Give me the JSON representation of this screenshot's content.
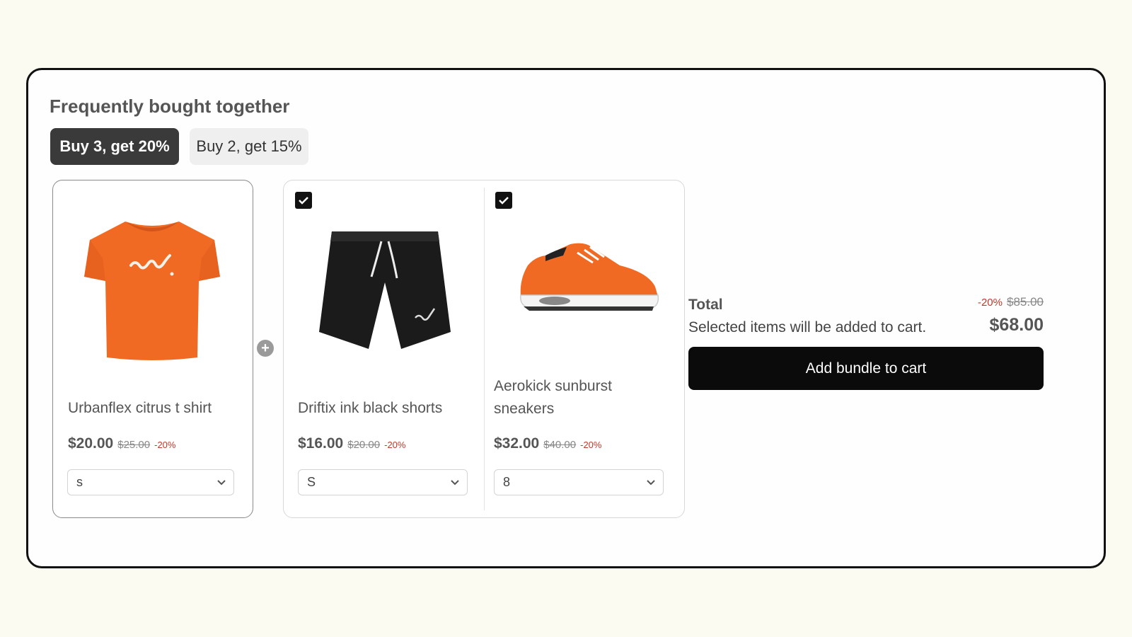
{
  "section": {
    "title": "Frequently bought together"
  },
  "tabs": [
    {
      "label": "Buy 3, get 20%",
      "active": true
    },
    {
      "label": "Buy 2, get 15%",
      "active": false
    }
  ],
  "products": [
    {
      "name": "Urbanflex citrus t shirt",
      "price": "$20.00",
      "compare_price": "$25.00",
      "discount": "-20%",
      "variant": "s",
      "checked": null,
      "icon": "orange-tshirt-image"
    },
    {
      "name": "Driftix ink black shorts",
      "price": "$16.00",
      "compare_price": "$20.00",
      "discount": "-20%",
      "variant": "S",
      "checked": true,
      "icon": "black-shorts-image"
    },
    {
      "name": "Aerokick sunburst sneakers",
      "price": "$32.00",
      "compare_price": "$40.00",
      "discount": "-20%",
      "variant": "8",
      "checked": true,
      "icon": "orange-sneaker-image"
    }
  ],
  "summary": {
    "total_label": "Total",
    "subtext": "Selected items will be added to cart.",
    "discount": "-20%",
    "compare_total": "$85.00",
    "total": "$68.00",
    "button_label": "Add bundle to cart"
  },
  "colors": {
    "accent": "#111111",
    "discount": "#c0392b",
    "product_orange": "#f06a23"
  }
}
